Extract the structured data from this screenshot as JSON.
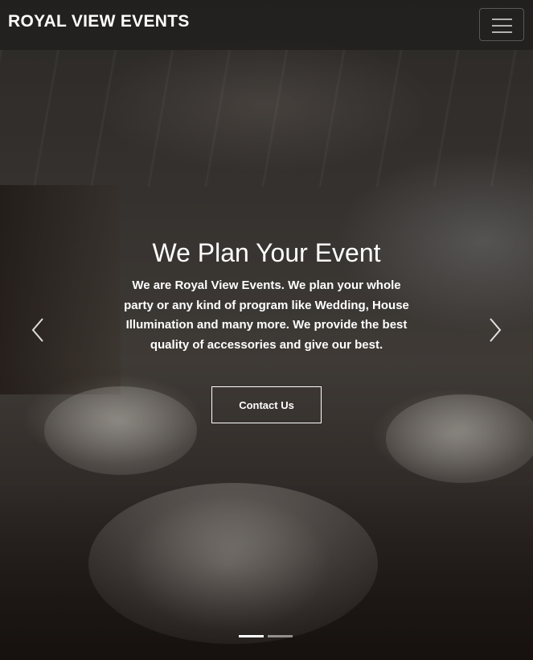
{
  "navbar": {
    "brand": "ROYAL VIEW EVENTS",
    "toggler_icon": "hamburger-menu-icon"
  },
  "hero": {
    "title": "We Plan Your Event",
    "description": "We are Royal View Events. We plan your whole party or any kind of program like Wedding, House Illumination and many more. We provide the best quality of accessories and give our best.",
    "cta_label": "Contact Us"
  },
  "carousel": {
    "prev_icon": "chevron-left-icon",
    "next_icon": "chevron-right-icon",
    "slide_count": 2,
    "active_slide": 1
  },
  "colors": {
    "text": "#ffffff",
    "navbar_bg": "rgba(25,25,25,0.55)"
  }
}
